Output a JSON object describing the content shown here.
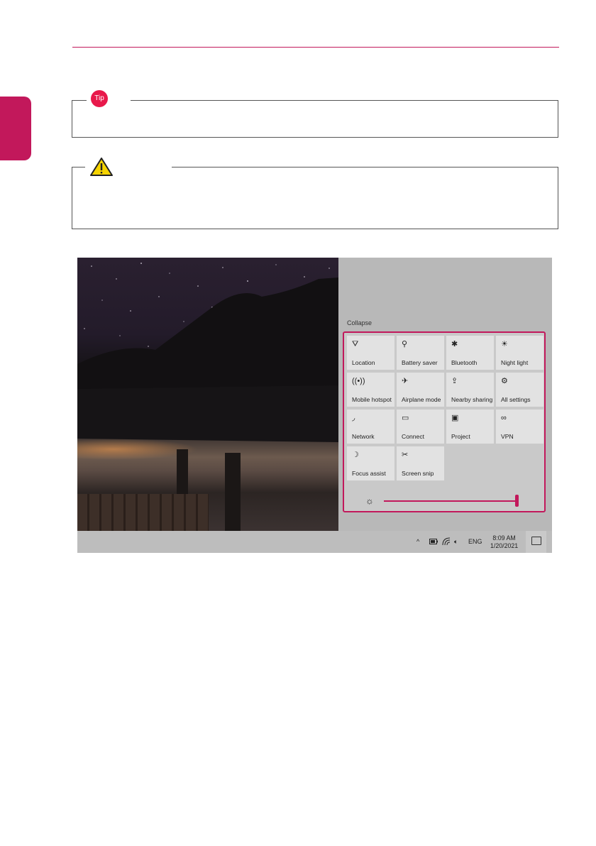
{
  "tip": {
    "badge": "Tip"
  },
  "screenshot": {
    "action_center": {
      "collapse_label": "Collapse",
      "tiles": [
        {
          "label": "Location",
          "icon": "location-icon"
        },
        {
          "label": "Battery saver",
          "icon": "battery-saver-icon"
        },
        {
          "label": "Bluetooth",
          "icon": "bluetooth-icon"
        },
        {
          "label": "Night light",
          "icon": "night-light-icon"
        },
        {
          "label": "Mobile hotspot",
          "icon": "mobile-hotspot-icon"
        },
        {
          "label": "Airplane mode",
          "icon": "airplane-icon"
        },
        {
          "label": "Nearby sharing",
          "icon": "nearby-sharing-icon"
        },
        {
          "label": "All settings",
          "icon": "gear-icon"
        },
        {
          "label": "Network",
          "icon": "network-icon"
        },
        {
          "label": "Connect",
          "icon": "connect-icon"
        },
        {
          "label": "Project",
          "icon": "project-icon"
        },
        {
          "label": "VPN",
          "icon": "vpn-icon"
        },
        {
          "label": "Focus assist",
          "icon": "moon-icon"
        },
        {
          "label": "Screen snip",
          "icon": "screen-snip-icon"
        }
      ],
      "brightness": {
        "icon": "brightness-icon",
        "level": 1.0
      }
    },
    "taskbar": {
      "language": "ENG",
      "time": "8:09 AM",
      "date": "1/20/2021"
    }
  },
  "colors": {
    "accent": "#c2185b",
    "tip": "#e8194b",
    "warning": "#f5d300"
  }
}
